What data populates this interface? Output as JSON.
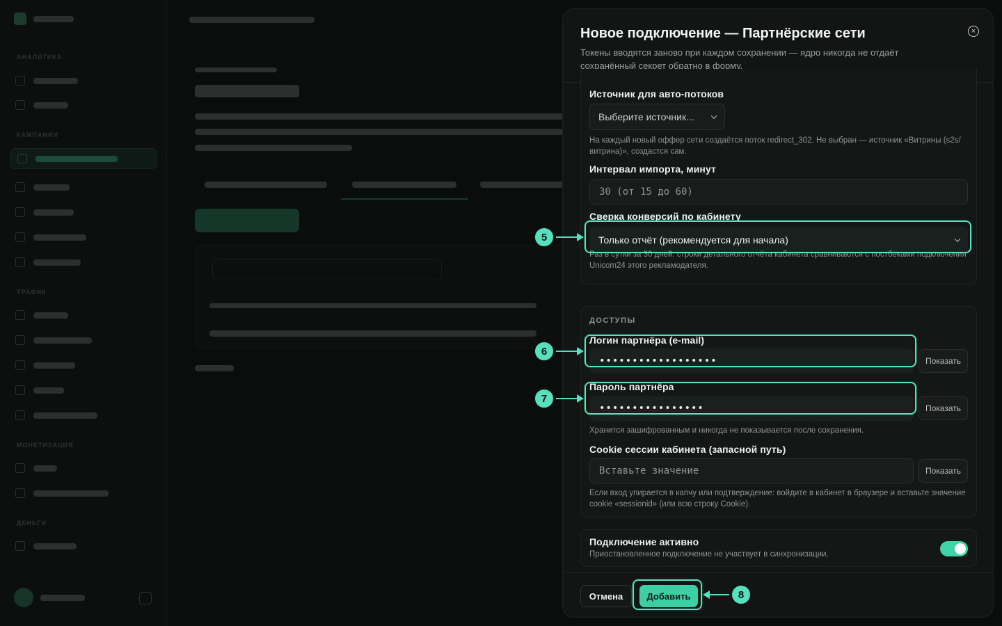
{
  "background": {
    "sidebar_sections": [
      "АНАЛИТИКА",
      "КАМПАНИИ",
      "ТРАФИК",
      "МОНЕТИЗАЦИЯ",
      "ДЕНЬГИ"
    ]
  },
  "modal": {
    "title": "Новое подключение — Партнёрские сети",
    "subtitle": "Токены вводятся заново при каждом сохранении — ядро никогда не отдаёт сохранённый секрет обратно в форму.",
    "close_icon": "close-icon",
    "autoflow": {
      "label": "Источник для авто-потоков",
      "select_value": "Выберите источник...",
      "hint": "На каждый новый оффер сети создаётся поток redirect_302. Не выбран — источник «Витрины (s2s/витрина)», создастся сам."
    },
    "interval": {
      "label": "Интервал импорта, минут",
      "placeholder": "30 (от 15 до 60)"
    },
    "reconcile": {
      "label": "Сверка конверсий по кабинету",
      "select_value": "Только отчёт (рекомендуется для начала)",
      "hint": "Раз в сутки за 30 дней: строки детального отчёта кабинета сравниваются с постбеками подключения Unicom24 этого рекламодателя."
    },
    "access": {
      "group_title": "ДОСТУПЫ",
      "login_label": "Логин партнёра (e-mail)",
      "login_value": "••••••••••••••••••",
      "password_label": "Пароль партнёра",
      "password_value": "••••••••••••••••",
      "password_hint": "Хранится зашифрованным и никогда не показывается после сохранения.",
      "cookie_label": "Cookie сессии кабинета (запасной путь)",
      "cookie_placeholder": "Вставьте значение",
      "cookie_hint": "Если вход упирается в капчу или подтверждение: войдите в кабинет в браузере и вставьте значение cookie «sessionid» (или всю строку Cookie).",
      "show_label": "Показать"
    },
    "active": {
      "label": "Подключение активно",
      "hint": "Приостановленное подключение не участвует в синхронизации.",
      "enabled": true
    },
    "footer": {
      "cancel_label": "Отмена",
      "add_label": "Добавить"
    }
  },
  "annotations": {
    "step5": "5",
    "step6": "6",
    "step7": "7",
    "step8": "8"
  },
  "colors": {
    "accent": "#3ecea4",
    "highlight": "#57e0bd",
    "modal_bg": "#121514"
  }
}
